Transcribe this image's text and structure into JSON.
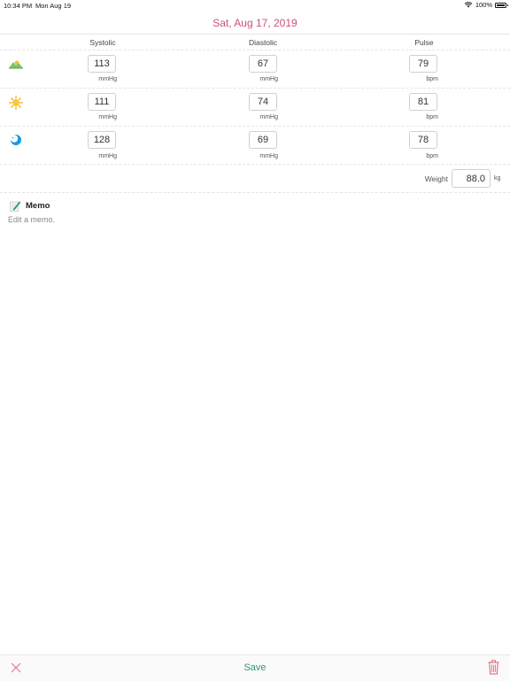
{
  "status_bar": {
    "time": "10:34 PM",
    "date": "Mon Aug 19",
    "battery": "100%"
  },
  "header": {
    "title": "Sat, Aug 17, 2019",
    "title_color": "#cc4f7f"
  },
  "columns": {
    "systolic": "Systolic",
    "diastolic": "Diastolic",
    "pulse": "Pulse"
  },
  "readings": [
    {
      "time_of_day_icon": "mountain-sunrise-icon",
      "systolic": "113",
      "systolic_unit": "mmHg",
      "diastolic": "67",
      "diastolic_unit": "mmHg",
      "pulse": "79",
      "pulse_unit": "bpm"
    },
    {
      "time_of_day_icon": "sun-icon",
      "systolic": "111",
      "systolic_unit": "mmHg",
      "diastolic": "74",
      "diastolic_unit": "mmHg",
      "pulse": "81",
      "pulse_unit": "bpm"
    },
    {
      "time_of_day_icon": "moon-icon",
      "systolic": "128",
      "systolic_unit": "mmHg",
      "diastolic": "69",
      "diastolic_unit": "mmHg",
      "pulse": "78",
      "pulse_unit": "bpm"
    }
  ],
  "weight": {
    "label": "Weight",
    "value": "88.0",
    "unit": "kg"
  },
  "memo": {
    "icon": "pencil-note-icon",
    "title": "Memo",
    "placeholder": "Edit a memo."
  },
  "toolbar": {
    "cancel_icon": "close-icon",
    "save_label": "Save",
    "save_color": "#2f9a6c",
    "delete_icon": "trash-icon",
    "delete_color": "#e05a6a"
  }
}
